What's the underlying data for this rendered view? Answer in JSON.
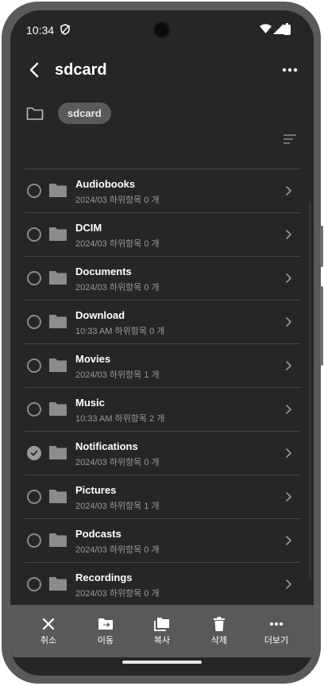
{
  "status_bar": {
    "time": "10:34"
  },
  "app_bar": {
    "title": "sdcard"
  },
  "breadcrumb": {
    "chip": "sdcard"
  },
  "folders": [
    {
      "name": "Audiobooks",
      "subtitle": "2024/03 하위항목 0 개",
      "checked": false
    },
    {
      "name": "DCIM",
      "subtitle": "2024/03 하위항목 0 개",
      "checked": false
    },
    {
      "name": "Documents",
      "subtitle": "2024/03 하위항목 0 개",
      "checked": false
    },
    {
      "name": "Download",
      "subtitle": "10:33 AM 하위항목 0 개",
      "checked": false
    },
    {
      "name": "Movies",
      "subtitle": "2024/03 하위항목 1 개",
      "checked": false
    },
    {
      "name": "Music",
      "subtitle": "10:33 AM 하위항목 2 개",
      "checked": false
    },
    {
      "name": "Notifications",
      "subtitle": "2024/03 하위항목 0 개",
      "checked": true
    },
    {
      "name": "Pictures",
      "subtitle": "2024/03 하위항목 1 개",
      "checked": false
    },
    {
      "name": "Podcasts",
      "subtitle": "2024/03 하위항목 0 개",
      "checked": false
    },
    {
      "name": "Recordings",
      "subtitle": "2024/03 하위항목 0 개",
      "checked": false
    }
  ],
  "bottom_bar": {
    "cancel": "취소",
    "move": "이동",
    "copy": "복사",
    "delete": "삭제",
    "more": "더보기"
  },
  "colors": {
    "background": "#262626",
    "bottom_bar": "#595959",
    "chip": "#5a5a5a",
    "secondary_text": "#9a9a9a"
  },
  "icons": [
    "back-icon",
    "more-icon",
    "folder-icon",
    "sort-icon",
    "chevron-right-icon",
    "close-icon",
    "move-icon",
    "copy-icon",
    "trash-icon"
  ]
}
